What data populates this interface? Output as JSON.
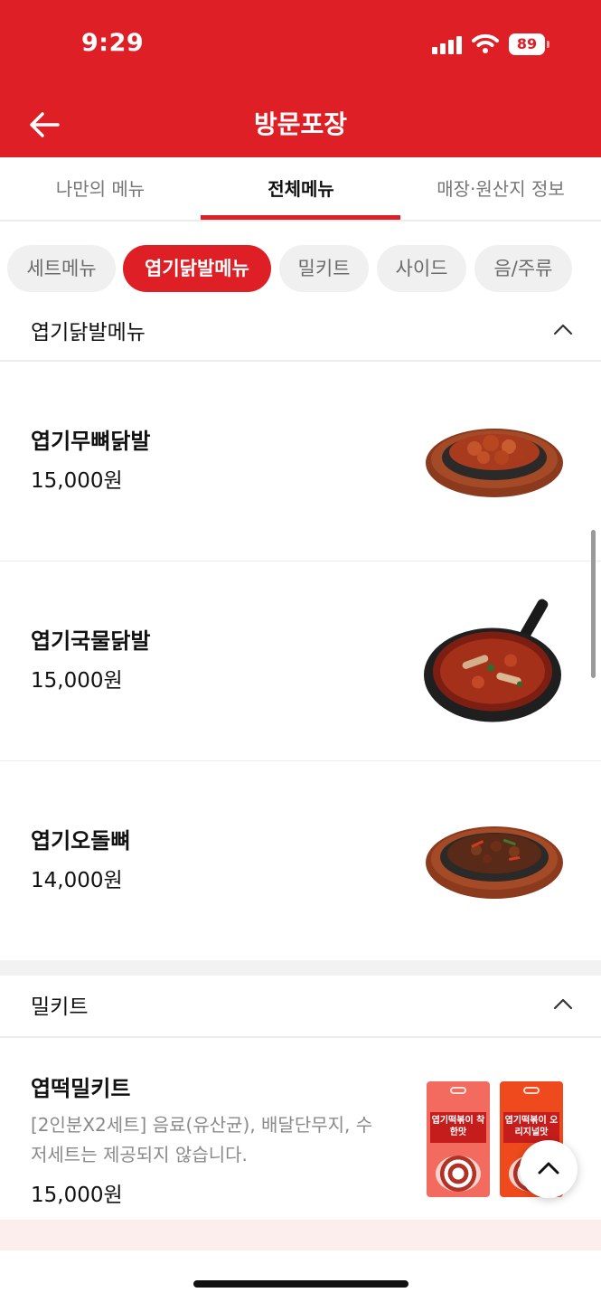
{
  "status_bar": {
    "time": "9:29",
    "battery": "89"
  },
  "header": {
    "title": "방문포장"
  },
  "tabs": [
    {
      "label": "나만의 메뉴",
      "active": false
    },
    {
      "label": "전체메뉴",
      "active": true
    },
    {
      "label": "매장·원산지 정보",
      "active": false
    }
  ],
  "chips": [
    {
      "label": "세트메뉴",
      "active": false
    },
    {
      "label": "엽기닭발메뉴",
      "active": true
    },
    {
      "label": "밀키트",
      "active": false
    },
    {
      "label": "사이드",
      "active": false
    },
    {
      "label": "음/주류",
      "active": false
    }
  ],
  "sections": {
    "dakbal": {
      "title": "엽기닭발메뉴",
      "items": [
        {
          "name": "엽기무뼈닭발",
          "price": "15,000원",
          "image": "boneless-chicken-feet-sizzling-plate"
        },
        {
          "name": "엽기국물닭발",
          "price": "15,000원",
          "image": "soup-chicken-feet-pan"
        },
        {
          "name": "엽기오돌뼈",
          "price": "14,000원",
          "image": "cartilage-sizzling-plate"
        }
      ]
    },
    "mealkit": {
      "title": "밀키트",
      "items": [
        {
          "name": "엽떡밀키트",
          "desc": "[2인분X2세트] 음료(유산균), 배달단무지, 수저세트는 제공되지 않습니다.",
          "price": "15,000원",
          "packs": [
            {
              "label": "엽기떡볶이 착한맛",
              "color": "#f36a5e"
            },
            {
              "label": "엽기떡볶이 오리지널맛",
              "color": "#ee4a1d"
            }
          ]
        }
      ]
    }
  },
  "colors": {
    "brand": "#df1f26",
    "chip_bg": "#f0f0f0",
    "muted_text": "#8a8a8a"
  },
  "icons": {
    "back": "arrow-left-icon",
    "collapse": "chevron-up-icon",
    "scroll_top": "chevron-up-icon"
  }
}
